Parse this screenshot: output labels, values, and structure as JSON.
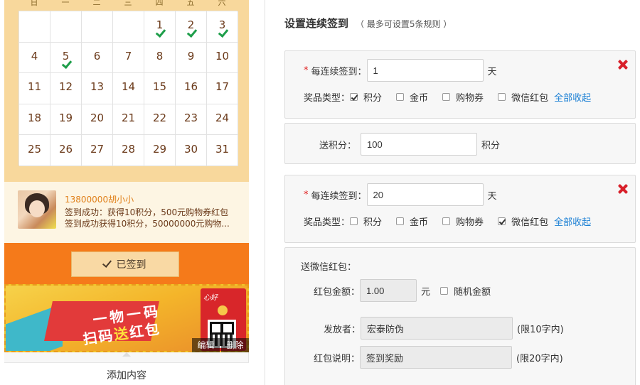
{
  "calendar": {
    "weekdays": [
      "日",
      "一",
      "二",
      "三",
      "四",
      "五",
      "六"
    ],
    "cells": [
      {
        "day": "",
        "checked": false
      },
      {
        "day": "",
        "checked": false
      },
      {
        "day": "",
        "checked": false
      },
      {
        "day": "",
        "checked": false
      },
      {
        "day": "1",
        "checked": true
      },
      {
        "day": "2",
        "checked": true
      },
      {
        "day": "3",
        "checked": true
      },
      {
        "day": "4",
        "checked": false
      },
      {
        "day": "5",
        "checked": true
      },
      {
        "day": "6",
        "checked": false
      },
      {
        "day": "7",
        "checked": false
      },
      {
        "day": "8",
        "checked": false
      },
      {
        "day": "9",
        "checked": false
      },
      {
        "day": "10",
        "checked": false
      },
      {
        "day": "11",
        "checked": false
      },
      {
        "day": "12",
        "checked": false
      },
      {
        "day": "13",
        "checked": false
      },
      {
        "day": "14",
        "checked": false
      },
      {
        "day": "15",
        "checked": false
      },
      {
        "day": "16",
        "checked": false
      },
      {
        "day": "17",
        "checked": false
      },
      {
        "day": "18",
        "checked": false
      },
      {
        "day": "19",
        "checked": false
      },
      {
        "day": "20",
        "checked": false
      },
      {
        "day": "21",
        "checked": false
      },
      {
        "day": "22",
        "checked": false
      },
      {
        "day": "23",
        "checked": false
      },
      {
        "day": "24",
        "checked": false
      },
      {
        "day": "25",
        "checked": false
      },
      {
        "day": "26",
        "checked": false
      },
      {
        "day": "27",
        "checked": false
      },
      {
        "day": "28",
        "checked": false
      },
      {
        "day": "29",
        "checked": false
      },
      {
        "day": "30",
        "checked": false
      },
      {
        "day": "31",
        "checked": false
      }
    ]
  },
  "user": {
    "name": "13800000胡小小",
    "line1": "签到成功：获得10积分，500元购物券红包",
    "line2": "签到成功获得10积分，50000000元购物..."
  },
  "signed_button": "已签到",
  "banner": {
    "text1": "一物一码",
    "text2a": "扫码",
    "text2b": "送",
    "text2c": "红包",
    "brand": "心好"
  },
  "edit_bar": {
    "edit": "编辑",
    "delete": "删除"
  },
  "add_content": "添加内容",
  "panel": {
    "title": "设置连续签到",
    "subtitle": "（ 最多可设置5条规则 ）",
    "rule1": {
      "label": "每连续签到：",
      "value": "1",
      "unit": "天",
      "prize_label": "奖品类型：",
      "options": [
        {
          "label": "积分",
          "checked": true
        },
        {
          "label": "金币",
          "checked": false
        },
        {
          "label": "购物券",
          "checked": false
        },
        {
          "label": "微信红包",
          "checked": false
        }
      ],
      "collapse": "全部收起"
    },
    "points": {
      "label": "送积分：",
      "value": "100",
      "unit": "积分"
    },
    "rule2": {
      "label": "每连续签到：",
      "value": "20",
      "unit": "天",
      "prize_label": "奖品类型：",
      "options": [
        {
          "label": "积分",
          "checked": false
        },
        {
          "label": "金币",
          "checked": false
        },
        {
          "label": "购物券",
          "checked": false
        },
        {
          "label": "微信红包",
          "checked": true
        }
      ],
      "collapse": "全部收起"
    },
    "wechat": {
      "title": "送微信红包：",
      "amount_label": "红包金额：",
      "amount_value": "1.00",
      "amount_unit": "元",
      "random_label": "随机金额",
      "random_checked": false,
      "sender_label": "发放者：",
      "sender_value": "宏泰防伪",
      "sender_limit": "(限10字内)",
      "desc_label": "红包说明：",
      "desc_value": "签到奖励",
      "desc_limit": "(限20字内)"
    }
  },
  "colors": {
    "accent_orange": "#f57a1a",
    "link_blue": "#1a7fd4",
    "check_green": "#1e9e4a",
    "delete_red": "#d8202a"
  }
}
